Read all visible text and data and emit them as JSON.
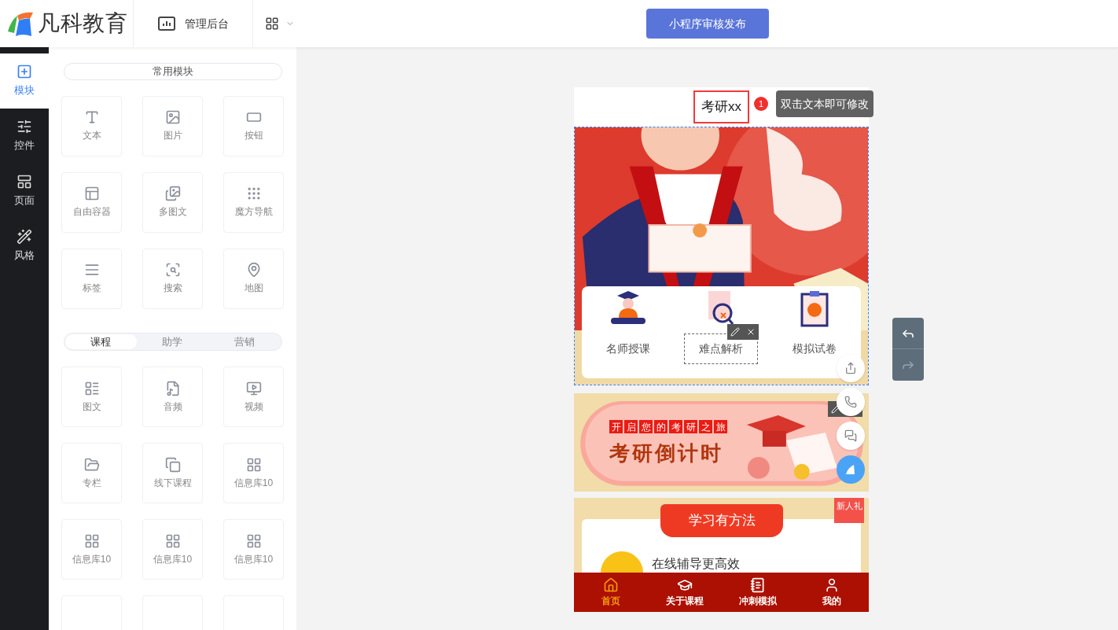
{
  "header": {
    "logo_text": "凡科教育",
    "admin_link": "管理后台",
    "publish_button": "小程序审核发布"
  },
  "rail": [
    {
      "label": "模块",
      "selected": true
    },
    {
      "label": "控件",
      "selected": false
    },
    {
      "label": "页面",
      "selected": false
    },
    {
      "label": "风格",
      "selected": false
    }
  ],
  "panel": {
    "common_button": "常用模块",
    "common_modules": [
      {
        "label": "文本"
      },
      {
        "label": "图片"
      },
      {
        "label": "按钮"
      },
      {
        "label": "自由容器"
      },
      {
        "label": "多图文"
      },
      {
        "label": "魔方导航"
      },
      {
        "label": "标签"
      },
      {
        "label": "搜索"
      },
      {
        "label": "地图"
      }
    ],
    "tabs": [
      {
        "label": "课程",
        "selected": true
      },
      {
        "label": "助学",
        "selected": false
      },
      {
        "label": "营销",
        "selected": false
      }
    ],
    "course_modules": [
      {
        "label": "图文"
      },
      {
        "label": "音频"
      },
      {
        "label": "视频"
      },
      {
        "label": "专栏"
      },
      {
        "label": "线下课程"
      },
      {
        "label": "信息库10"
      },
      {
        "label": "信息库10"
      },
      {
        "label": "信息库10"
      },
      {
        "label": "信息库10"
      }
    ]
  },
  "preview": {
    "title": "考研xx",
    "step_badge": "1",
    "tooltip": "双击文本即可修改",
    "hero_nav": [
      {
        "label": "名师授课",
        "selected": false
      },
      {
        "label": "难点解析",
        "selected": true
      },
      {
        "label": "模拟试卷",
        "selected": false
      }
    ],
    "banner": {
      "tagline_chars": [
        "开",
        "启",
        "您",
        "的",
        "考",
        "研",
        "之",
        "旅"
      ],
      "title": "考研倒计时"
    },
    "gift_badge": "新人礼",
    "section_title": "学习有方法",
    "feature": "在线辅导更高效",
    "tab_bar": [
      {
        "label": "首页",
        "selected": true
      },
      {
        "label": "关于课程",
        "selected": false
      },
      {
        "label": "冲刺模拟",
        "selected": false
      },
      {
        "label": "我的",
        "selected": false
      }
    ]
  }
}
